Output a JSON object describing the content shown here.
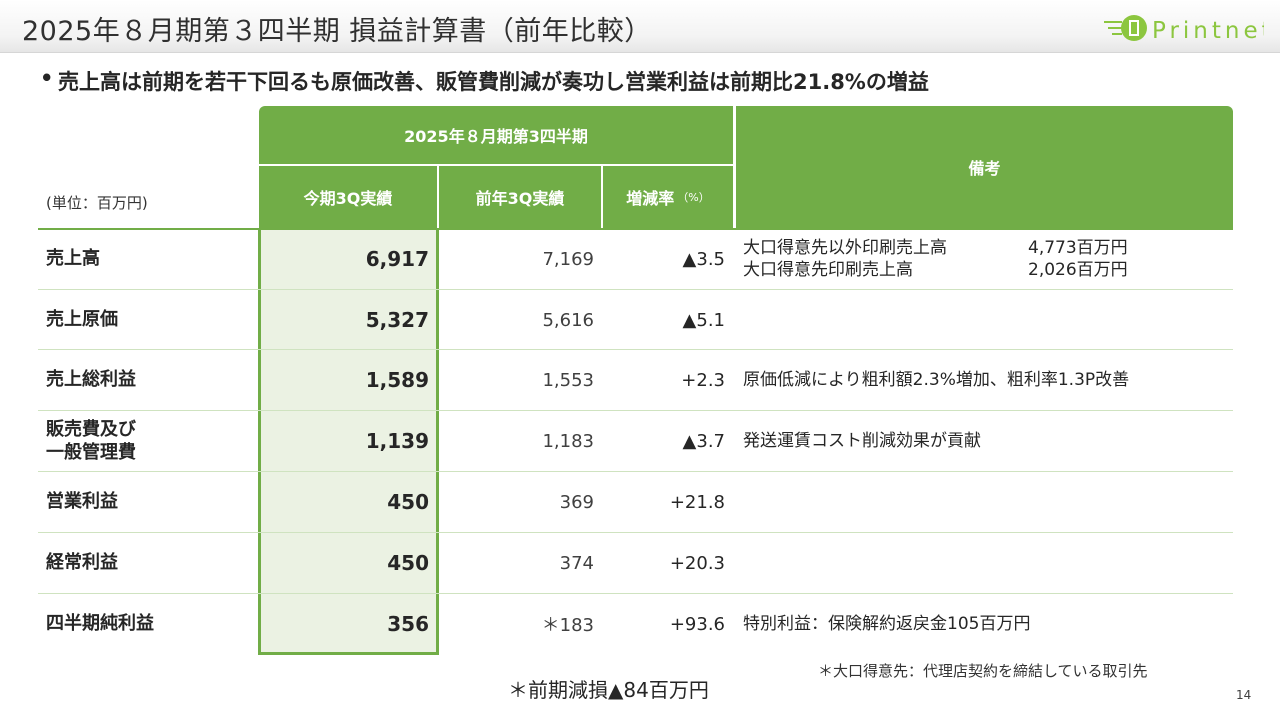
{
  "slide": {
    "title": "2025年８月期第３四半期 損益計算書（前年比較）",
    "headline": "売上高は前期を若干下回るも原価改善、販管費削減が奏功し営業利益は前期比21.8%の増益",
    "bullet": "•",
    "logo_text": "Printnet",
    "page_number": "14"
  },
  "table": {
    "unit": "(単位：百万円)",
    "group_header": "2025年８月期第3四半期",
    "remarks_header": "備考",
    "col_current": "今期3Q実績",
    "col_previous": "前年3Q実績",
    "col_rate": "増減率",
    "col_rate_unit": "（%）",
    "rows": [
      {
        "label": "売上高",
        "current": "6,917",
        "previous": "7,169",
        "rate": "▲3.5",
        "note1_label": "大口得意先以外印刷売上高",
        "note1_value": "4,773百万円",
        "note2_label": "大口得意先印刷売上高",
        "note2_value": "2,026百万円"
      },
      {
        "label": "売上原価",
        "current": "5,327",
        "previous": "5,616",
        "rate": "▲5.1",
        "note": ""
      },
      {
        "label": "売上総利益",
        "current": "1,589",
        "previous": "1,553",
        "rate": "+2.3",
        "note": "原価低減により粗利額2.3%増加、粗利率1.3P改善"
      },
      {
        "label_line1": "販売費及び",
        "label_line2": "一般管理費",
        "current": "1,139",
        "previous": "1,183",
        "rate": "▲3.7",
        "note": "発送運賃コスト削減効果が貢献"
      },
      {
        "label": "営業利益",
        "current": "450",
        "previous": "369",
        "rate": "+21.8",
        "note": ""
      },
      {
        "label": "経常利益",
        "current": "450",
        "previous": "374",
        "rate": "+20.3",
        "note": ""
      },
      {
        "label": "四半期純利益",
        "current": "356",
        "previous": "＊183",
        "rate": "+93.6",
        "note": "特別利益：保険解約返戻金105百万円"
      }
    ]
  },
  "footnotes": {
    "impairment": "＊前期減損▲84百万円",
    "definition": "＊大口得意先：代理店契約を締結している取引先"
  },
  "colors": {
    "header_green": "#71ad47",
    "highlight_fill": "#ebf2e3",
    "logo_green": "#8cc63f"
  }
}
